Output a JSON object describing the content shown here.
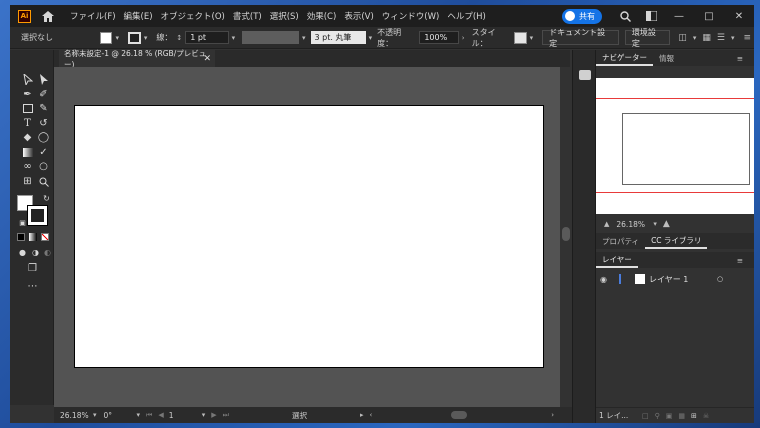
{
  "app": {
    "logo_text": "Ai",
    "menu": [
      "ファイル(F)",
      "編集(E)",
      "オブジェクト(O)",
      "書式(T)",
      "選択(S)",
      "効果(C)",
      "表示(V)",
      "ウィンドウ(W)",
      "ヘルプ(H)"
    ],
    "share_label": "共有",
    "accent_color": "#1473e6"
  },
  "control_bar": {
    "selection": "選択なし",
    "stroke_label": "線：",
    "stroke_weight": "1 pt",
    "brush": "3 pt. 丸筆",
    "opacity_label": "不透明度：",
    "opacity_value": "100%",
    "style_label": "スタイル：",
    "doc_settings": "ドキュメント設定",
    "preferences": "環境設定"
  },
  "document": {
    "tab_title": "名称未設定-1 @ 26.18 % (RGB/プレビュー)"
  },
  "status_bar": {
    "zoom": "26.18%",
    "rotation": "0°",
    "artboard": "1",
    "tool": "選択"
  },
  "panels": {
    "navigator_tabs": [
      "ナビゲーター",
      "情報"
    ],
    "nav_zoom": "26.18%",
    "props_tabs": [
      "プロパティ",
      "CC ライブラリ"
    ],
    "layers_tab": "レイヤー",
    "layer_name": "レイヤー 1",
    "layers_footer": "1 レイ..."
  }
}
